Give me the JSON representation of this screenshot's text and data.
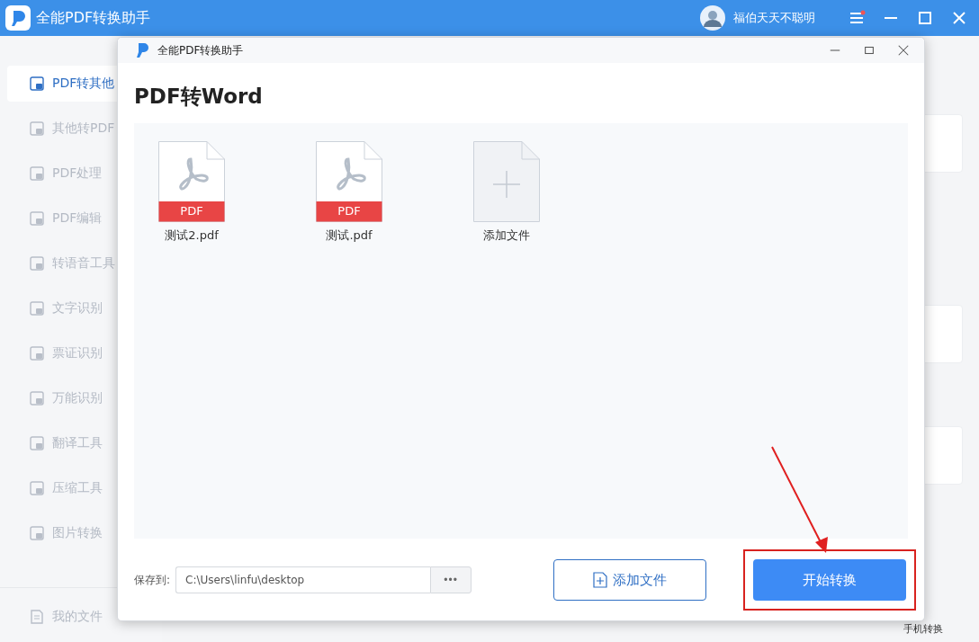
{
  "app": {
    "title": "全能PDF转换助手",
    "user": {
      "name": "福伯天天不聪明"
    }
  },
  "sidebar": {
    "items": [
      {
        "label": "PDF转其他",
        "selected": true
      },
      {
        "label": "其他转PDF",
        "selected": false
      },
      {
        "label": "PDF处理",
        "selected": false
      },
      {
        "label": "PDF编辑",
        "selected": false
      },
      {
        "label": "转语音工具",
        "selected": false
      },
      {
        "label": "文字识别",
        "selected": false
      },
      {
        "label": "票证识别",
        "selected": false
      },
      {
        "label": "万能识别",
        "selected": false
      },
      {
        "label": "翻译工具",
        "selected": false
      },
      {
        "label": "压缩工具",
        "selected": false
      },
      {
        "label": "图片转换",
        "selected": false
      }
    ],
    "footer_item": "我的文件"
  },
  "background": {
    "corner_label": "手机转换"
  },
  "dialog": {
    "title": "全能PDF转换助手",
    "heading": "PDF转Word",
    "files": [
      {
        "name": "测试2.pdf",
        "kind": "pdf",
        "badge": "PDF"
      },
      {
        "name": "测试.pdf",
        "kind": "pdf",
        "badge": "PDF"
      },
      {
        "name": "添加文件",
        "kind": "add"
      }
    ],
    "save_to": {
      "label": "保存到:",
      "value": "C:\\Users\\linfu\\desktop",
      "browse": "•••"
    },
    "buttons": [
      {
        "label": "添加文件",
        "kind": "secondary",
        "highlighted": false
      },
      {
        "label": "开始转换",
        "kind": "primary",
        "highlighted": true
      }
    ]
  }
}
